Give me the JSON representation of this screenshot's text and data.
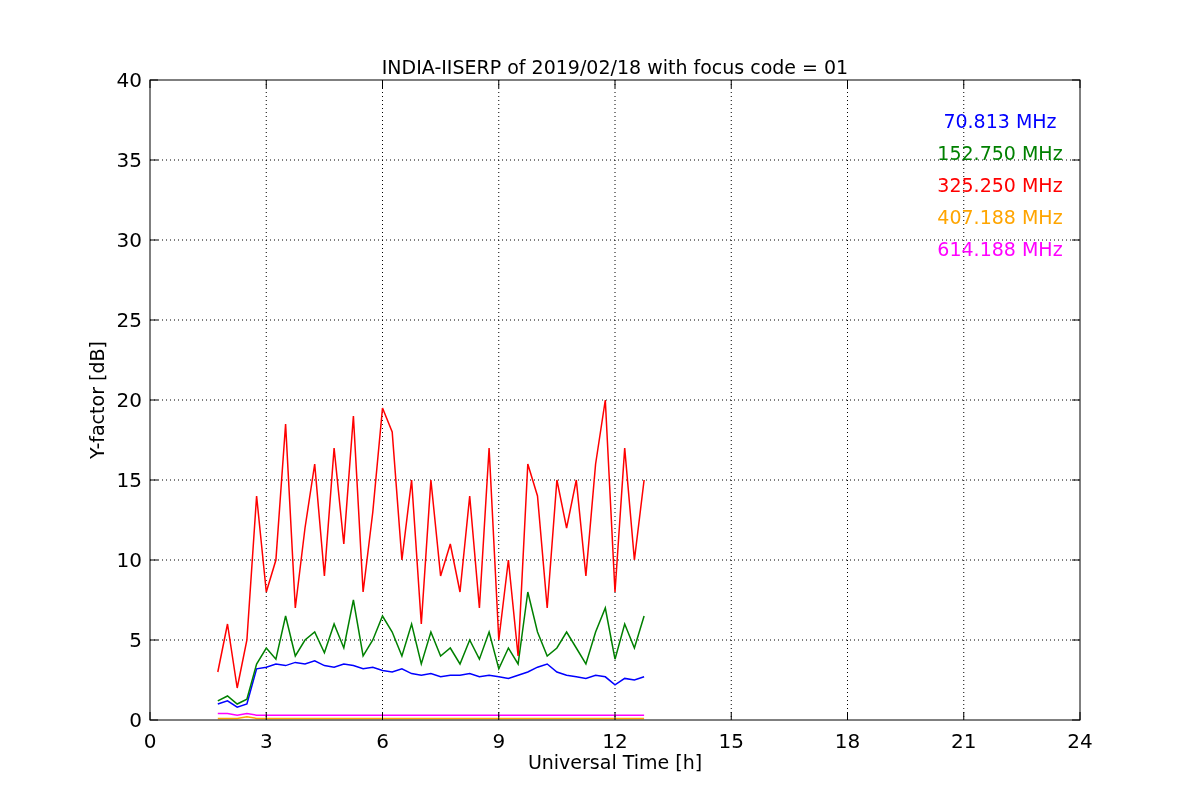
{
  "chart_data": {
    "type": "line",
    "title": "INDIA-IISERP of 2019/02/18 with focus code = 01",
    "xlabel": "Universal Time [h]",
    "ylabel": "Y-factor [dB]",
    "xlim": [
      0,
      24
    ],
    "ylim": [
      0,
      40
    ],
    "xticks": [
      0,
      3,
      6,
      9,
      12,
      15,
      18,
      21,
      24
    ],
    "yticks": [
      0,
      5,
      10,
      15,
      20,
      25,
      30,
      35,
      40
    ],
    "grid": true,
    "x": [
      1.75,
      2.0,
      2.25,
      2.5,
      2.75,
      3.0,
      3.25,
      3.5,
      3.75,
      4.0,
      4.25,
      4.5,
      4.75,
      5.0,
      5.25,
      5.5,
      5.75,
      6.0,
      6.25,
      6.5,
      6.75,
      7.0,
      7.25,
      7.5,
      7.75,
      8.0,
      8.25,
      8.5,
      8.75,
      9.0,
      9.25,
      9.5,
      9.75,
      10.0,
      10.25,
      10.5,
      10.75,
      11.0,
      11.25,
      11.5,
      11.75,
      12.0,
      12.25,
      12.5,
      12.75
    ],
    "series": [
      {
        "name": "70.813 MHz",
        "color": "#0000ff",
        "values": [
          1.0,
          1.2,
          0.8,
          1.0,
          3.2,
          3.3,
          3.5,
          3.4,
          3.6,
          3.5,
          3.7,
          3.4,
          3.3,
          3.5,
          3.4,
          3.2,
          3.3,
          3.1,
          3.0,
          3.2,
          2.9,
          2.8,
          2.9,
          2.7,
          2.8,
          2.8,
          2.9,
          2.7,
          2.8,
          2.7,
          2.6,
          2.8,
          3.0,
          3.3,
          3.5,
          3.0,
          2.8,
          2.7,
          2.6,
          2.8,
          2.7,
          2.2,
          2.6,
          2.5,
          2.7
        ]
      },
      {
        "name": "152.750 MHz",
        "color": "#008000",
        "values": [
          1.2,
          1.5,
          1.0,
          1.3,
          3.5,
          4.5,
          3.8,
          6.5,
          4.0,
          5.0,
          5.5,
          4.2,
          6.0,
          4.5,
          7.5,
          4.0,
          5.0,
          6.5,
          5.5,
          4.0,
          6.0,
          3.5,
          5.5,
          4.0,
          4.5,
          3.5,
          5.0,
          3.8,
          5.5,
          3.2,
          4.5,
          3.5,
          8.0,
          5.5,
          4.0,
          4.5,
          5.5,
          4.5,
          3.5,
          5.5,
          7.0,
          3.8,
          6.0,
          4.5,
          6.5
        ]
      },
      {
        "name": "325.250 MHz",
        "color": "#ff0000",
        "values": [
          3.0,
          6.0,
          2.0,
          5.0,
          14.0,
          8.0,
          10.0,
          18.5,
          7.0,
          12.0,
          16.0,
          9.0,
          17.0,
          11.0,
          19.0,
          8.0,
          13.0,
          19.5,
          18.0,
          10.0,
          15.0,
          6.0,
          15.0,
          9.0,
          11.0,
          8.0,
          14.0,
          7.0,
          17.0,
          5.0,
          10.0,
          4.0,
          16.0,
          14.0,
          7.0,
          15.0,
          12.0,
          15.0,
          9.0,
          16.0,
          20.0,
          8.0,
          17.0,
          10.0,
          15.0
        ]
      },
      {
        "name": "407.188 MHz",
        "color": "#ffa500",
        "values": [
          0.1,
          0.1,
          0.1,
          0.2,
          0.1,
          0.1,
          0.1,
          0.1,
          0.1,
          0.1,
          0.1,
          0.1,
          0.1,
          0.1,
          0.1,
          0.1,
          0.1,
          0.1,
          0.1,
          0.1,
          0.1,
          0.1,
          0.1,
          0.1,
          0.1,
          0.1,
          0.1,
          0.1,
          0.1,
          0.1,
          0.1,
          0.1,
          0.1,
          0.1,
          0.1,
          0.1,
          0.1,
          0.1,
          0.1,
          0.1,
          0.1,
          0.1,
          0.1,
          0.1,
          0.1
        ]
      },
      {
        "name": "614.188 MHz",
        "color": "#ff00ff",
        "values": [
          0.4,
          0.4,
          0.3,
          0.4,
          0.3,
          0.3,
          0.3,
          0.3,
          0.3,
          0.3,
          0.3,
          0.3,
          0.3,
          0.3,
          0.3,
          0.3,
          0.3,
          0.3,
          0.3,
          0.3,
          0.3,
          0.3,
          0.3,
          0.3,
          0.3,
          0.3,
          0.3,
          0.3,
          0.3,
          0.3,
          0.3,
          0.3,
          0.3,
          0.3,
          0.3,
          0.3,
          0.3,
          0.3,
          0.3,
          0.3,
          0.3,
          0.3,
          0.3,
          0.3,
          0.3
        ]
      }
    ]
  }
}
